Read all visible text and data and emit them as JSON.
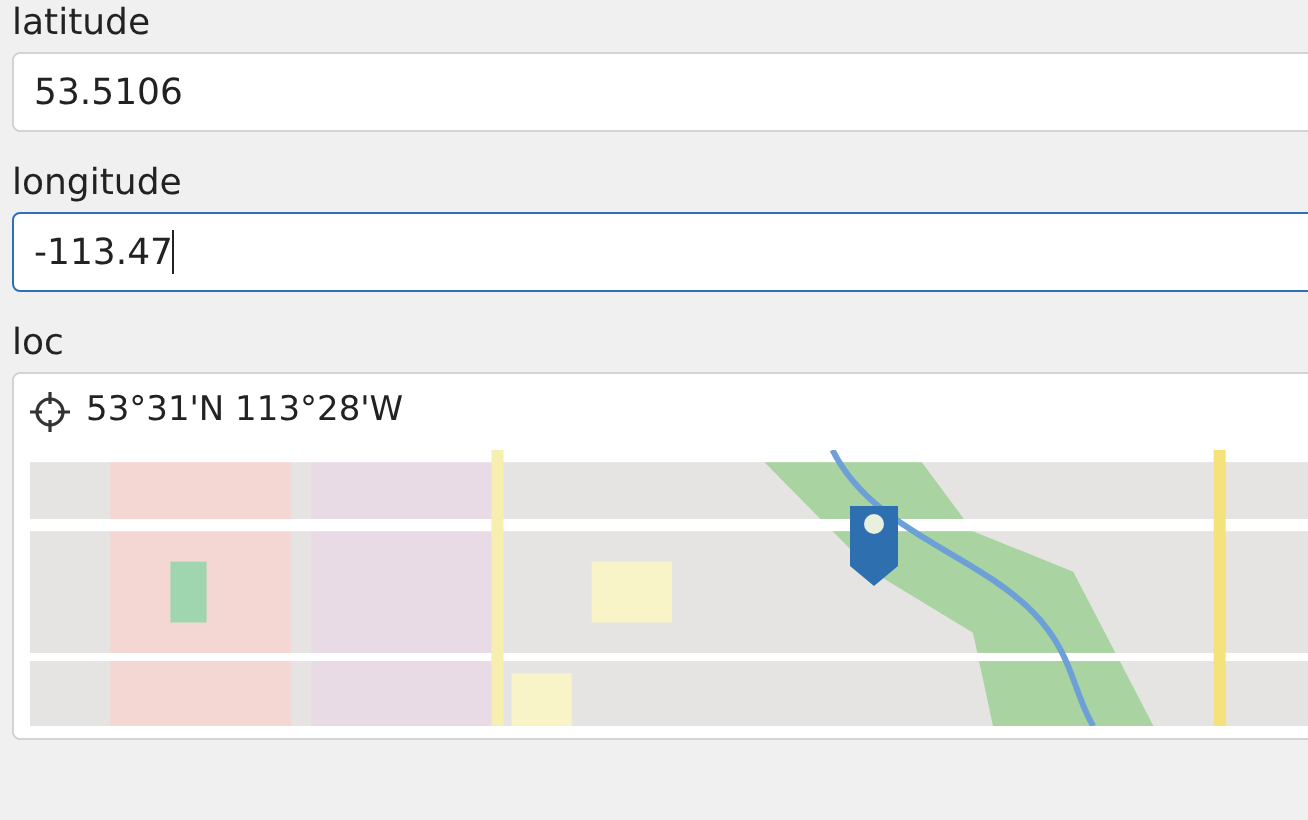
{
  "fields": [
    {
      "label": "latitude",
      "value": "53.5106",
      "focused": false
    },
    {
      "label": "longitude",
      "value": "-113.47",
      "focused": true
    }
  ],
  "location": {
    "label": "loc",
    "coordinates": "53°31'N 113°28'W"
  }
}
